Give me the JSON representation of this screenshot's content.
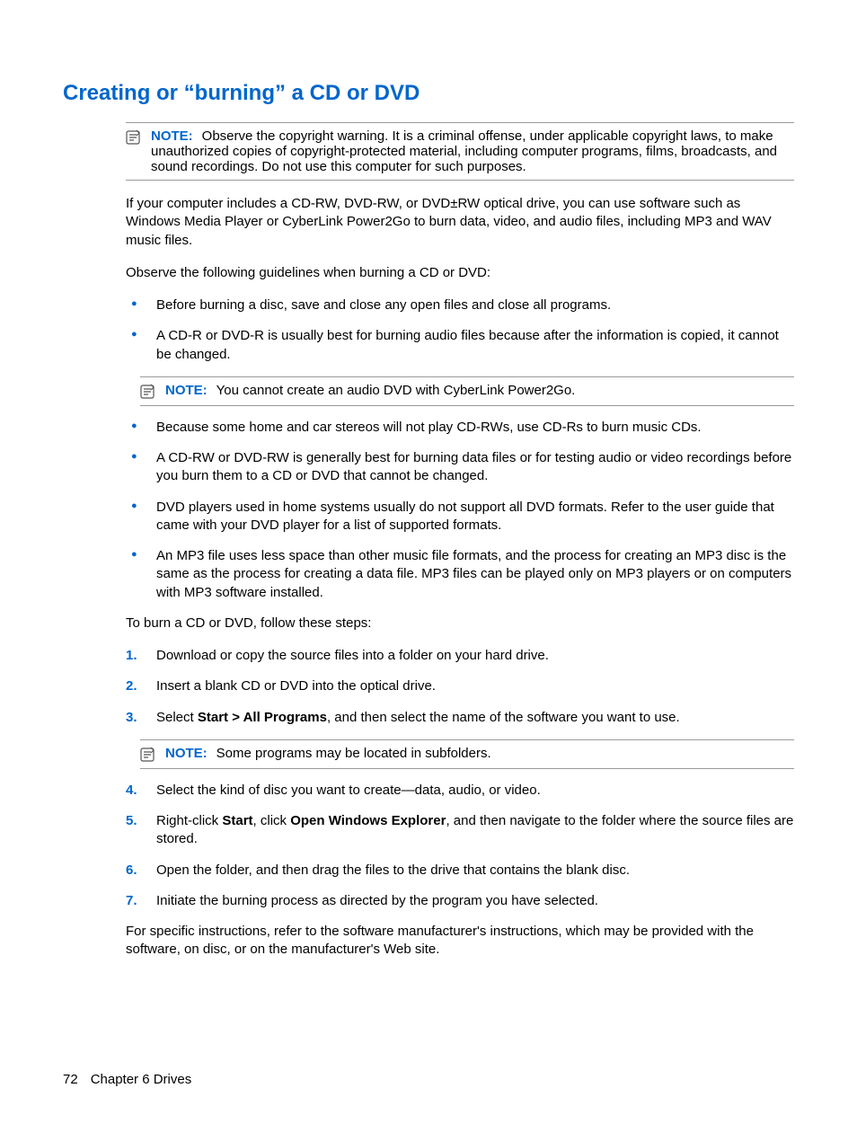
{
  "heading": "Creating or “burning” a CD or DVD",
  "notes": {
    "label": "NOTE:",
    "n1": "Observe the copyright warning. It is a criminal offense, under applicable copyright laws, to make unauthorized copies of copyright-protected material, including computer programs, films, broadcasts, and sound recordings. Do not use this computer for such purposes.",
    "n2": "You cannot create an audio DVD with CyberLink Power2Go.",
    "n3": "Some programs may be located in subfolders."
  },
  "p1": "If your computer includes a CD-RW, DVD-RW, or DVD±RW optical drive, you can use software such as Windows Media Player or CyberLink Power2Go to burn data, video, and audio files, including MP3 and WAV music files.",
  "p2": "Observe the following guidelines when burning a CD or DVD:",
  "bullets": [
    "Before burning a disc, save and close any open files and close all programs.",
    "A CD-R or DVD-R is usually best for burning audio files because after the information is copied, it cannot be changed.",
    "Because some home and car stereos will not play CD-RWs, use CD-Rs to burn music CDs.",
    "A CD-RW or DVD-RW is generally best for burning data files or for testing audio or video recordings before you burn them to a CD or DVD that cannot be changed.",
    "DVD players used in home systems usually do not support all DVD formats. Refer to the user guide that came with your DVD player for a list of supported formats.",
    "An MP3 file uses less space than other music file formats, and the process for creating an MP3 disc is the same as the process for creating a data file. MP3 files can be played only on MP3 players or on computers with MP3 software installed."
  ],
  "p3": "To burn a CD or DVD, follow these steps:",
  "steps": {
    "s1": "Download or copy the source files into a folder on your hard drive.",
    "s2": "Insert a blank CD or DVD into the optical drive.",
    "s3_pre": "Select ",
    "s3_bold": "Start > All Programs",
    "s3_post": ", and then select the name of the software you want to use.",
    "s4": "Select the kind of disc you want to create—data, audio, or video.",
    "s5_a": "Right-click ",
    "s5_b1": "Start",
    "s5_b": ", click ",
    "s5_b2": "Open Windows Explorer",
    "s5_c": ", and then navigate to the folder where the source files are stored.",
    "s6": "Open the folder, and then drag the files to the drive that contains the blank disc.",
    "s7": "Initiate the burning process as directed by the program you have selected."
  },
  "p4": "For specific instructions, refer to the software manufacturer's instructions, which may be provided with the software, on disc, or on the manufacturer's Web site.",
  "footer": {
    "page": "72",
    "chapter": "Chapter 6   Drives"
  }
}
